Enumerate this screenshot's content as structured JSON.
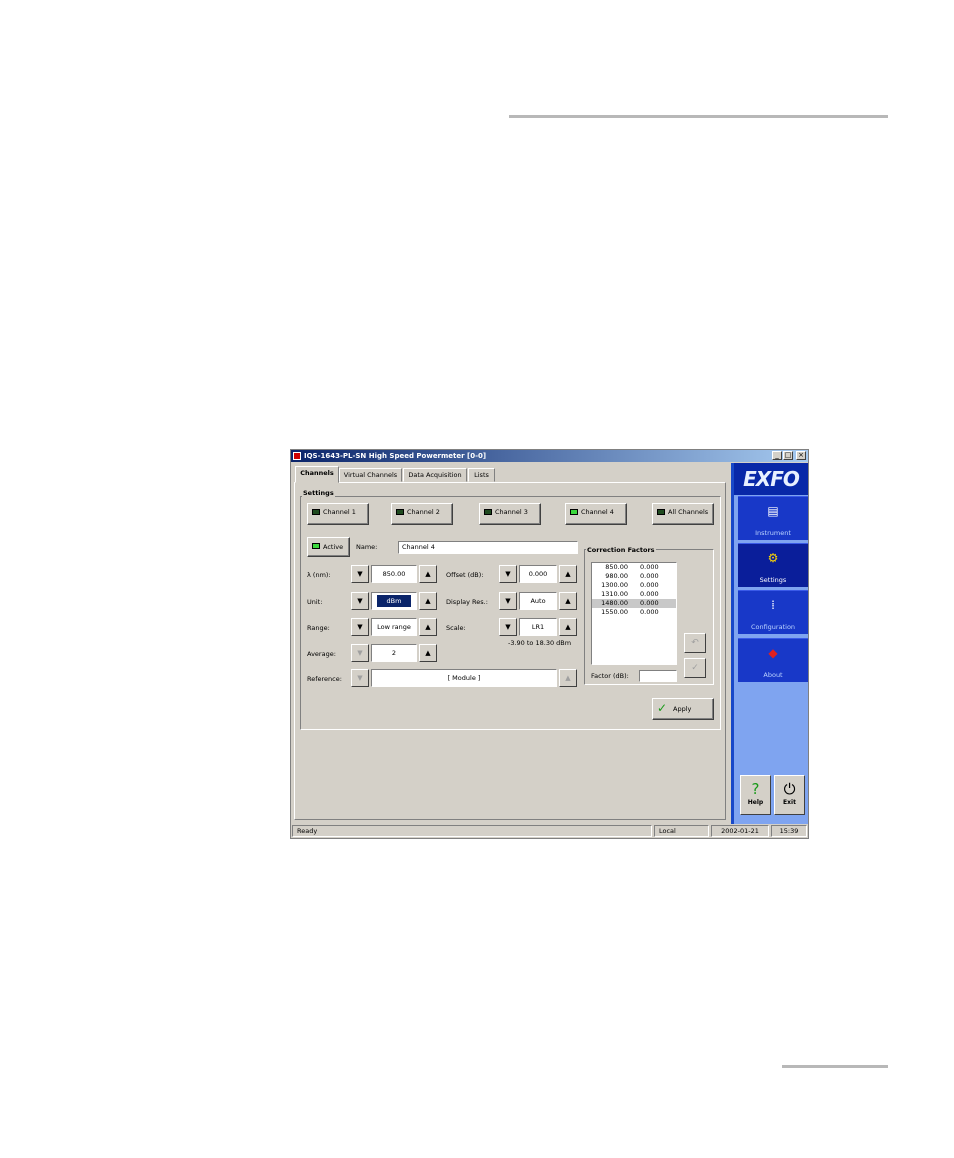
{
  "window": {
    "title": "IQS-1643-PL-SN High Speed Powermeter [0-0]",
    "minimize": "_",
    "maximize": "□",
    "close": "×"
  },
  "tabs": [
    {
      "label": "Channels"
    },
    {
      "label": "Virtual Channels"
    },
    {
      "label": "Data Acquisition"
    },
    {
      "label": "Lists"
    }
  ],
  "settings": {
    "group_label": "Settings",
    "channels": [
      "Channel 1",
      "Channel 2",
      "Channel 3",
      "Channel 4",
      "All Channels"
    ],
    "active_channel": "Channel 4",
    "active_label": "Active",
    "name_label": "Name:",
    "name_value": "Channel 4",
    "wavelength_label": "λ (nm):",
    "wavelength_value": "850.00",
    "unit_label": "Unit:",
    "unit_value": "dBm",
    "range_label": "Range:",
    "range_value": "Low range",
    "average_label": "Average:",
    "average_value": "2",
    "offset_label": "Offset (dB):",
    "offset_value": "0.000",
    "display_res_label": "Display Res.:",
    "display_res_value": "Auto",
    "scale_label": "Scale:",
    "scale_value": "LR1",
    "scale_range": "-3.90 to 18.30 dBm",
    "reference_label": "Reference:",
    "reference_value": "[ Module ]",
    "apply_label": "Apply"
  },
  "correction": {
    "group_label": "Correction Factors",
    "rows": [
      {
        "wl": "850.00",
        "cf": "0.000"
      },
      {
        "wl": "980.00",
        "cf": "0.000"
      },
      {
        "wl": "1300.00",
        "cf": "0.000"
      },
      {
        "wl": "1310.00",
        "cf": "0.000"
      },
      {
        "wl": "1480.00",
        "cf": "0.000"
      },
      {
        "wl": "1550.00",
        "cf": "0.000"
      }
    ],
    "selected_index": 4,
    "factor_label": "Factor (dB):",
    "factor_value": ""
  },
  "sidebar": {
    "logo": "EXFO",
    "items": [
      {
        "label": "Instrument",
        "icon": "instrument-icon"
      },
      {
        "label": "Settings",
        "icon": "settings-icon"
      },
      {
        "label": "Configuration",
        "icon": "configuration-icon"
      },
      {
        "label": "About",
        "icon": "about-icon"
      }
    ],
    "active": "Settings",
    "help_label": "Help",
    "exit_label": "Exit"
  },
  "statusbar": {
    "status": "Ready",
    "mode": "Local",
    "date": "2002-01-21",
    "time": "15:39"
  }
}
